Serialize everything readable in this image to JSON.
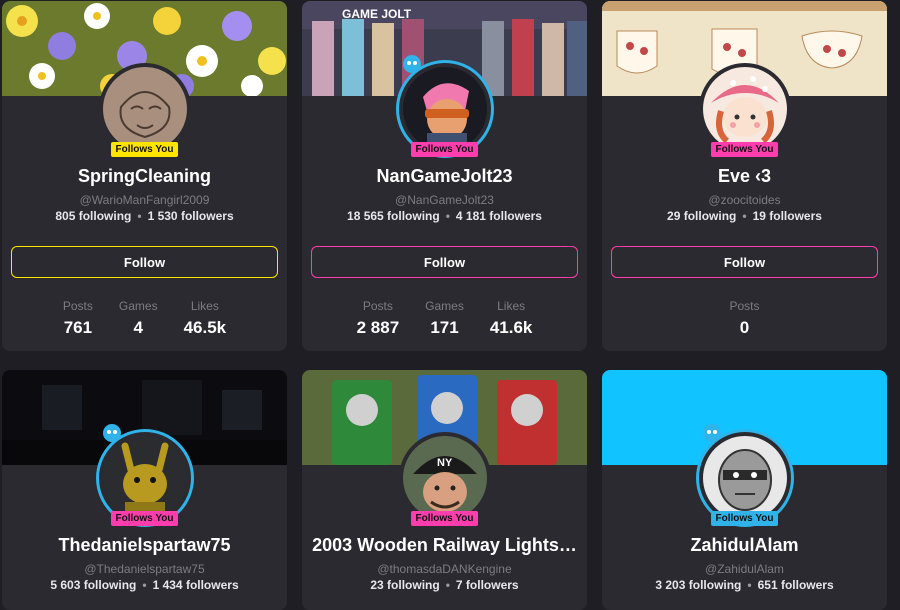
{
  "cards": [
    {
      "name": "SpringCleaning",
      "handle": "@WarioManFangirl2009",
      "following": "805 following",
      "followers": "1 530 followers",
      "badge": "Follows You",
      "follow_label": "Follow",
      "stats": [
        {
          "label": "Posts",
          "value": "761"
        },
        {
          "label": "Games",
          "value": "4"
        },
        {
          "label": "Likes",
          "value": "46.5k"
        }
      ]
    },
    {
      "name": "NanGameJolt23",
      "handle": "@NanGameJolt23",
      "following": "18 565 following",
      "followers": "4 181 followers",
      "badge": "Follows You",
      "follow_label": "Follow",
      "banner_text": "GAME JOLT",
      "stats": [
        {
          "label": "Posts",
          "value": "2 887"
        },
        {
          "label": "Games",
          "value": "171"
        },
        {
          "label": "Likes",
          "value": "41.6k"
        }
      ]
    },
    {
      "name": "Eve ‹3",
      "handle": "@zoocitoides",
      "following": "29 following",
      "followers": "19 followers",
      "badge": "Follows You",
      "follow_label": "Follow",
      "stats": [
        {
          "label": "Posts",
          "value": "0"
        }
      ]
    },
    {
      "name": "Thedanielspartaw75",
      "handle": "@Thedanielspartaw75",
      "following": "5 603 following",
      "followers": "1 434 followers",
      "badge": "Follows You"
    },
    {
      "name": "2003 Wooden Railway Lights…",
      "handle": "@thomasdaDANKengine",
      "following": "23 following",
      "followers": "7 followers",
      "badge": "Follows You",
      "avatar_text": "NY"
    },
    {
      "name": "ZahidulAlam",
      "handle": "@ZahidulAlam",
      "following": "3 203 following",
      "followers": "651 followers",
      "badge": "Follows You"
    }
  ],
  "colors": {
    "background": "#1f1e24",
    "card": "#2b2a30",
    "yellow_accent": "#ffe600",
    "pink_accent": "#ff3dac",
    "blue_accent": "#2fb3e8"
  }
}
